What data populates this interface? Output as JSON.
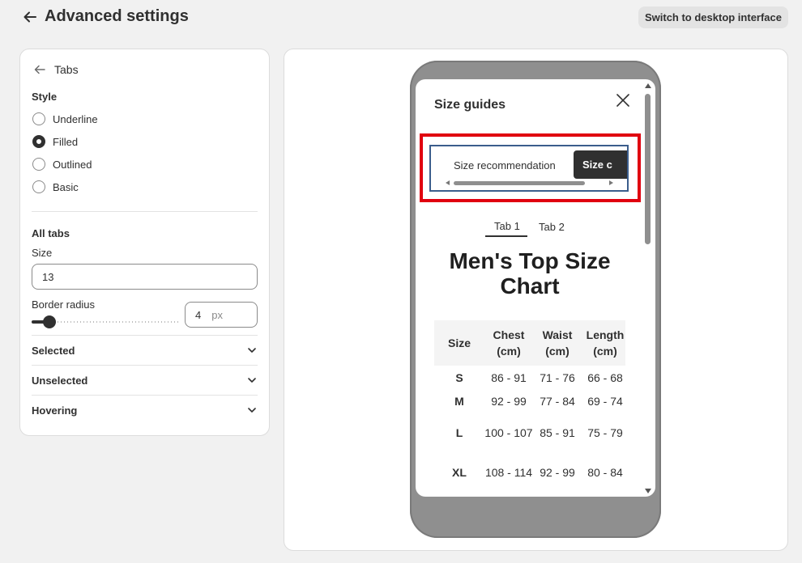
{
  "header": {
    "title": "Advanced settings",
    "desktop_button": "Switch to desktop interface"
  },
  "left_panel": {
    "back_label": "Tabs",
    "style_title": "Style",
    "style_options": [
      "Underline",
      "Filled",
      "Outlined",
      "Basic"
    ],
    "style_selected": "Filled",
    "all_tabs_title": "All tabs",
    "size_label": "Size",
    "size_value": "13",
    "border_radius_label": "Border radius",
    "border_radius_value": "4",
    "border_radius_unit": "px",
    "accordions": [
      "Selected",
      "Unselected",
      "Hovering"
    ]
  },
  "preview": {
    "modal_title": "Size guides",
    "tabs": [
      "Size recommendation",
      "Size c"
    ],
    "inner_tabs": [
      "Tab 1",
      "Tab 2"
    ],
    "chart_title": "Men's Top Size Chart",
    "table": {
      "headers": [
        "Size",
        "Chest (cm)",
        "Waist (cm)",
        "Length (cm)"
      ],
      "rows": [
        [
          "S",
          "86 - 91",
          "71 - 76",
          "66 - 68"
        ],
        [
          "M",
          "92 - 99",
          "77 - 84",
          "69 - 74"
        ],
        [
          "L",
          "100 - 107",
          "85 - 91",
          "75 - 79"
        ],
        [
          "XL",
          "108 - 114",
          "92 - 99",
          "80 - 84"
        ]
      ]
    }
  },
  "colors": {
    "highlight": "#e0000f",
    "tabs_frame": "#3b5d8c",
    "selected_tab": "#303030"
  }
}
